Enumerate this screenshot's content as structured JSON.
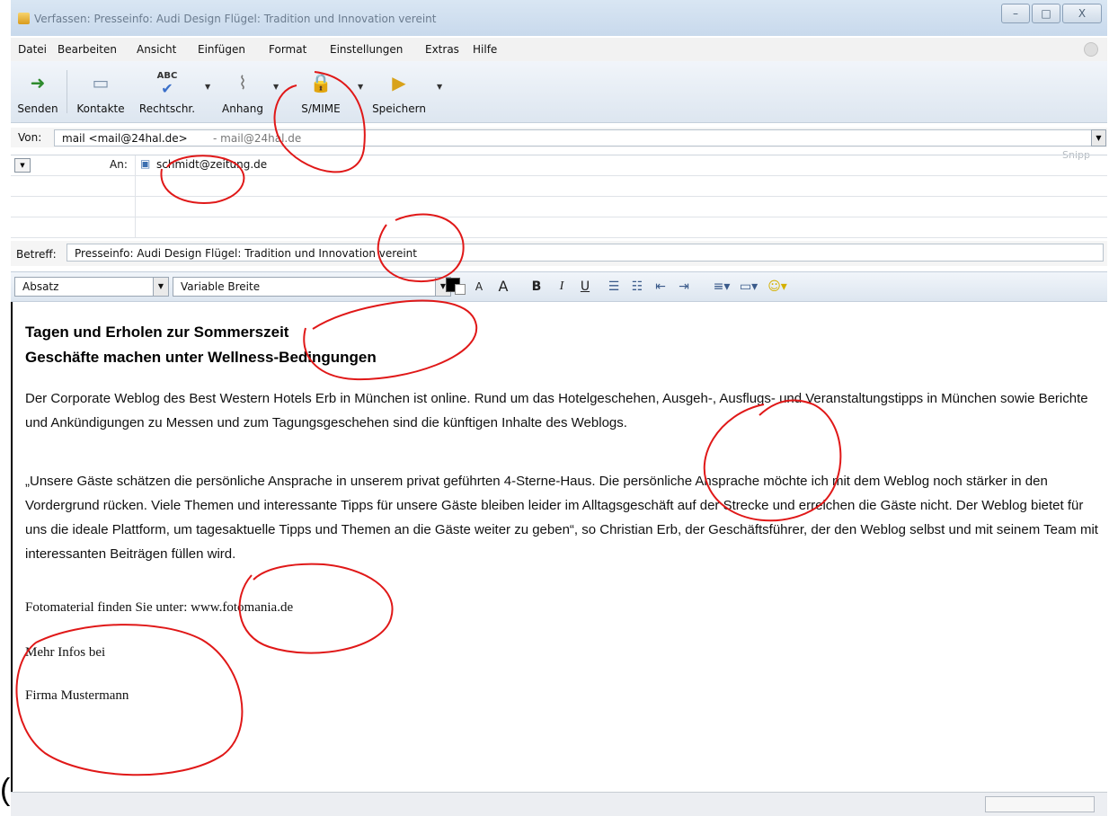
{
  "window": {
    "title": "Verfassen: Presseinfo: Audi Design Flügel: Tradition und Innovation vereint",
    "minimize": "–",
    "maximize": "□",
    "close": "X"
  },
  "menubar": [
    "Datei",
    "Bearbeiten",
    "Ansicht",
    "Einfügen",
    "Format",
    "Einstellungen",
    "Extras",
    "Hilfe"
  ],
  "toolbar": {
    "send": "Senden",
    "contacts": "Kontakte",
    "spell": "Rechtschr.",
    "attach": "Anhang",
    "smime": "S/MIME",
    "save": "Speichern",
    "spell_icon_text": "ABC"
  },
  "header": {
    "from_label": "Von:",
    "from_value": "mail <mail@24hal.de>",
    "from_alt": "- mail@24hal.de",
    "snippet": "Snipp",
    "to_type": "An:",
    "to_address": "schmidt@zeitung.de",
    "subject_label": "Betreff:",
    "subject_value": "Presseinfo: Audi Design Flügel: Tradition und Innovation vereint"
  },
  "format": {
    "paragraph_style": "Absatz",
    "font": "Variable Breite",
    "bold": "B",
    "italic": "I",
    "underline": "U",
    "smaller": "A",
    "larger": "A"
  },
  "body": {
    "heading1": "Tagen und Erholen zur Sommerszeit",
    "heading2": "Geschäfte machen unter Wellness-Bedingungen",
    "para1": "Der Corporate Weblog des Best Western Hotels Erb in München  ist online. Rund um das Hotelgeschehen, Ausgeh-, Ausflugs- und Veranstaltungstipps in München sowie Berichte und Ankündigungen zu Messen und zum Tagungsgeschehen sind die künftigen Inhalte des Weblogs.",
    "para2": "„Unsere Gäste schätzen die persönliche Ansprache in unserem privat geführten 4-Sterne-Haus. Die persönliche Ansprache möchte ich mit dem Weblog noch stärker in den Vordergrund rücken. Viele Themen und interessante Tipps für unsere Gäste bleiben leider im Alltagsgeschäft auf der Strecke und erreichen die Gäste nicht. Der Weblog bietet für uns die ideale Plattform, um tagesaktuelle Tipps und Themen an die Gäste weiter zu geben“, so Christian Erb, der Geschäftsführer, der den Weblog selbst und mit seinem Team mit interessanten Beiträgen füllen wird.",
    "photo_line": "Fotomaterial finden Sie unter: www.fotomania.de",
    "more_info": "Mehr Infos bei",
    "company": "Firma Mustermann"
  },
  "annotation_color": "#e01818",
  "left_glyph": "("
}
